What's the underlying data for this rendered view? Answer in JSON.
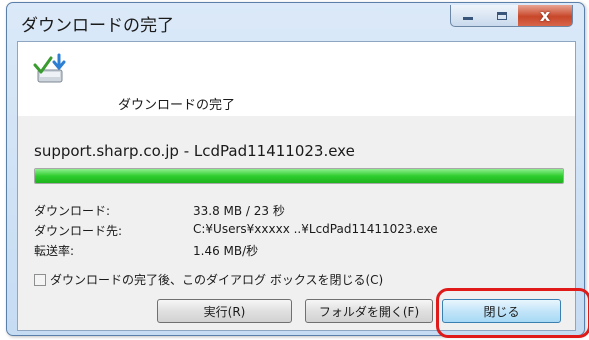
{
  "window": {
    "title": "ダウンロードの完了",
    "controls": {
      "close_glyph": "x"
    }
  },
  "header": {
    "icon": "download-complete-icon",
    "text": "ダウンロードの完了"
  },
  "download": {
    "filename": "support.sharp.co.jp - LcdPad11411023.exe",
    "progress_percent": 100
  },
  "info": [
    {
      "label": "ダウンロード:",
      "value": "33.8 MB / 23 秒"
    },
    {
      "label": "ダウンロード先:",
      "value": "C:¥Users¥xxxxx ..¥LcdPad11411023.exe"
    },
    {
      "label": "転送率:",
      "value": "1.46 MB/秒"
    }
  ],
  "checkbox": {
    "label": "ダウンロードの完了後、このダイアログ ボックスを閉じる(C)",
    "checked": false
  },
  "buttons": {
    "run": "実行(R)",
    "open_folder": "フォルダを開く(F)",
    "close": "閉じる"
  },
  "colors": {
    "highlight": "#e01919",
    "progress": "#2fcd2f"
  }
}
